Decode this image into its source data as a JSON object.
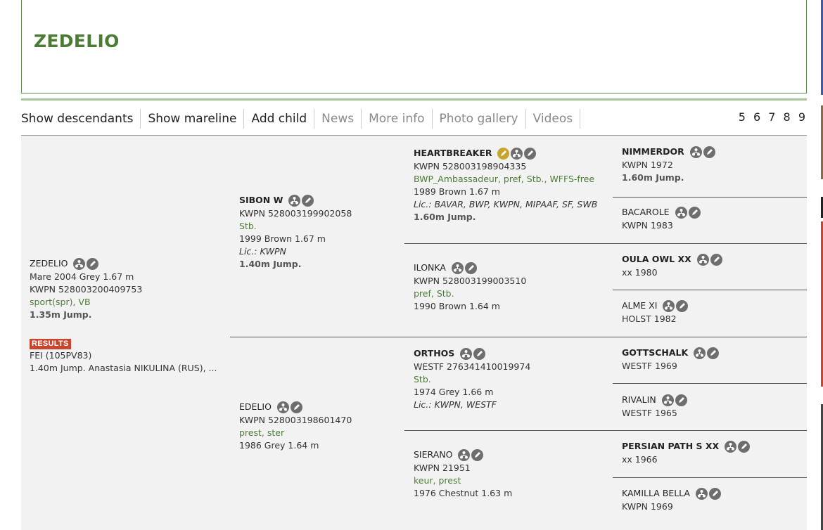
{
  "title": "ZEDELIO",
  "nav": {
    "items": [
      {
        "label": "Show descendants",
        "muted": false
      },
      {
        "label": "Show mareline",
        "muted": false
      },
      {
        "label": "Add child",
        "muted": false
      },
      {
        "label": "News",
        "muted": true
      },
      {
        "label": "More info",
        "muted": true
      },
      {
        "label": "Photo gallery",
        "muted": true
      },
      {
        "label": "Videos",
        "muted": true
      }
    ],
    "generations": "5 6 7 8 9"
  },
  "subject": {
    "name": "ZEDELIO",
    "line1": "Mare 2004 Grey 1.67 m",
    "line2": "KWPN 528003200409753",
    "predicates": "sport(spr), VB",
    "level": "1.35m Jump.",
    "results_badge": "RESULTS",
    "fei": "FEI (105PV83)",
    "result": "1.40m Jump. Anastasia NIKULINA (RUS), ..."
  },
  "sire": {
    "name": "SIBON W",
    "reg": "KWPN 528003199902058",
    "predicates": "Stb.",
    "info": "1999 Brown 1.67 m",
    "lic": "Lic.: KWPN",
    "level": "1.40m Jump."
  },
  "dam": {
    "name": "EDELIO",
    "reg": "KWPN 528003198601470",
    "predicates": "prest, ster",
    "info": "1986 Grey 1.64 m"
  },
  "gen3": [
    {
      "name": "HEARTBREAKER",
      "reg": "KWPN 528003198904335",
      "predicates": "BWP_Ambassadeur, pref, Stb., WFFS-free",
      "info": "1989 Brown 1.67 m",
      "lic": "Lic.: BAVAR, BWP, KWPN, MIPAAF, SF, SWB",
      "level": "1.60m Jump."
    },
    {
      "name": "ILONKA",
      "reg": "KWPN 528003199003510",
      "predicates": "pref, Stb.",
      "info": "1990 Brown 1.64 m"
    },
    {
      "name": "ORTHOS",
      "reg": "WESTF 276341410019974",
      "predicates": "Stb.",
      "info": "1974 Grey 1.66 m",
      "lic": "Lic.: KWPN, WESTF"
    },
    {
      "name": "SIERANO",
      "reg": "KWPN 21951",
      "predicates": "keur, prest",
      "info": "1976 Chestnut 1.63 m"
    }
  ],
  "gen4": [
    {
      "name": "NIMMERDOR",
      "info": "KWPN 1972",
      "level": "1.60m Jump.",
      "bold": true
    },
    {
      "name": "BACAROLE",
      "info": "KWPN 1983",
      "bold": false
    },
    {
      "name": "OULA OWL XX",
      "info": "xx 1980",
      "bold": true
    },
    {
      "name": "ALME XI",
      "info": "HOLST 1982",
      "bold": false
    },
    {
      "name": "GOTTSCHALK",
      "info": "WESTF 1969",
      "bold": true
    },
    {
      "name": "RIVALIN",
      "info": "WESTF 1965",
      "bold": false
    },
    {
      "name": "PERSIAN PATH S XX",
      "info": "xx 1966",
      "bold": true
    },
    {
      "name": "KAMILLA BELLA",
      "info": "KWPN 1969",
      "bold": false
    }
  ],
  "colors": {
    "title_green": "#4a7c34",
    "predicate_green": "#4e7c38",
    "results_red": "#c8452e",
    "icon_grey": "#6e6e6e",
    "icon_gold": "#c8a52a"
  }
}
